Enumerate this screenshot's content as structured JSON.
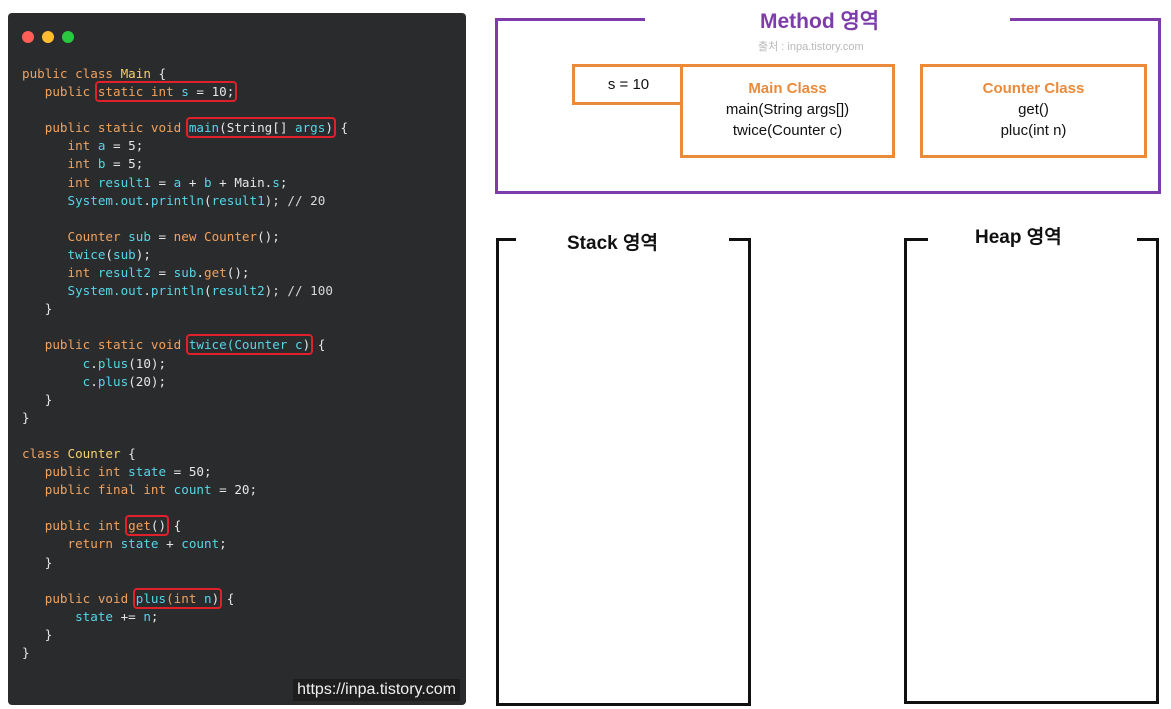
{
  "code_panel": {
    "watermark": "https://inpa.tistory.com",
    "lines": [
      [
        {
          "t": "public ",
          "c": "kw"
        },
        {
          "t": "class ",
          "c": "kw"
        },
        {
          "t": "Main",
          "c": "cls"
        },
        {
          "t": " {",
          "c": "plain"
        }
      ],
      [
        {
          "t": "   public",
          "c": "kw"
        },
        {
          "t": " ",
          "c": "plain"
        },
        {
          "t": "static int ",
          "c": "kw",
          "hl": true
        },
        {
          "t": "s",
          "c": "id",
          "hl": true
        },
        {
          "t": " = 10;",
          "c": "plain",
          "hl": true
        }
      ],
      [],
      [
        {
          "t": "   public static void ",
          "c": "kw"
        },
        {
          "t": "main",
          "c": "id",
          "hl": true
        },
        {
          "t": "(String[] ",
          "c": "plain",
          "hl": true
        },
        {
          "t": "args",
          "c": "id",
          "hl": true
        },
        {
          "t": ")",
          "c": "plain",
          "hl": true
        },
        {
          "t": " {",
          "c": "plain"
        }
      ],
      [
        {
          "t": "      int ",
          "c": "kw"
        },
        {
          "t": "a",
          "c": "id"
        },
        {
          "t": " = 5;",
          "c": "plain"
        }
      ],
      [
        {
          "t": "      int ",
          "c": "kw"
        },
        {
          "t": "b",
          "c": "id"
        },
        {
          "t": " = 5;",
          "c": "plain"
        }
      ],
      [
        {
          "t": "      int ",
          "c": "kw"
        },
        {
          "t": "result1",
          "c": "id"
        },
        {
          "t": " = ",
          "c": "plain"
        },
        {
          "t": "a",
          "c": "id"
        },
        {
          "t": " + ",
          "c": "plain"
        },
        {
          "t": "b",
          "c": "id"
        },
        {
          "t": " + Main.",
          "c": "plain"
        },
        {
          "t": "s",
          "c": "id"
        },
        {
          "t": ";",
          "c": "plain"
        }
      ],
      [
        {
          "t": "      System.",
          "c": "id"
        },
        {
          "t": "out",
          "c": "id"
        },
        {
          "t": ".",
          "c": "plain"
        },
        {
          "t": "println",
          "c": "id"
        },
        {
          "t": "(",
          "c": "plain"
        },
        {
          "t": "result1",
          "c": "id"
        },
        {
          "t": "); // 20",
          "c": "cmt"
        }
      ],
      [],
      [
        {
          "t": "      Counter ",
          "c": "kw"
        },
        {
          "t": "sub",
          "c": "id"
        },
        {
          "t": " = ",
          "c": "plain"
        },
        {
          "t": "new ",
          "c": "kw"
        },
        {
          "t": "Counter",
          "c": "kw"
        },
        {
          "t": "();",
          "c": "plain"
        }
      ],
      [
        {
          "t": "      twice",
          "c": "id"
        },
        {
          "t": "(",
          "c": "plain"
        },
        {
          "t": "sub",
          "c": "id"
        },
        {
          "t": ");",
          "c": "plain"
        }
      ],
      [
        {
          "t": "      int ",
          "c": "kw"
        },
        {
          "t": "result2",
          "c": "id"
        },
        {
          "t": " = ",
          "c": "plain"
        },
        {
          "t": "sub",
          "c": "id"
        },
        {
          "t": ".",
          "c": "plain"
        },
        {
          "t": "get",
          "c": "kw"
        },
        {
          "t": "();",
          "c": "plain"
        }
      ],
      [
        {
          "t": "      System.",
          "c": "id"
        },
        {
          "t": "out",
          "c": "id"
        },
        {
          "t": ".",
          "c": "plain"
        },
        {
          "t": "println",
          "c": "id"
        },
        {
          "t": "(",
          "c": "plain"
        },
        {
          "t": "result2",
          "c": "id"
        },
        {
          "t": "); // 100",
          "c": "cmt"
        }
      ],
      [
        {
          "t": "   }",
          "c": "plain"
        }
      ],
      [],
      [
        {
          "t": "   public static void ",
          "c": "kw"
        },
        {
          "t": "twice",
          "c": "id",
          "hl": true
        },
        {
          "t": "(Counter ",
          "c": "id",
          "hl": true
        },
        {
          "t": "c",
          "c": "id",
          "hl": true
        },
        {
          "t": ")",
          "c": "plain",
          "hl": true
        },
        {
          "t": " {",
          "c": "plain"
        }
      ],
      [
        {
          "t": "        c",
          "c": "id"
        },
        {
          "t": ".",
          "c": "plain"
        },
        {
          "t": "plus",
          "c": "id"
        },
        {
          "t": "(10);",
          "c": "plain"
        }
      ],
      [
        {
          "t": "        c",
          "c": "id"
        },
        {
          "t": ".",
          "c": "plain"
        },
        {
          "t": "plus",
          "c": "id"
        },
        {
          "t": "(20);",
          "c": "plain"
        }
      ],
      [
        {
          "t": "   }",
          "c": "plain"
        }
      ],
      [
        {
          "t": "}",
          "c": "plain"
        }
      ],
      [],
      [
        {
          "t": "class ",
          "c": "kw"
        },
        {
          "t": "Counter",
          "c": "cls"
        },
        {
          "t": " {",
          "c": "plain"
        }
      ],
      [
        {
          "t": "   public int ",
          "c": "kw"
        },
        {
          "t": "state",
          "c": "id"
        },
        {
          "t": " = 50;",
          "c": "plain"
        }
      ],
      [
        {
          "t": "   public final int ",
          "c": "kw"
        },
        {
          "t": "count",
          "c": "id"
        },
        {
          "t": " = 20;",
          "c": "plain"
        }
      ],
      [],
      [
        {
          "t": "   public int",
          "c": "kw"
        },
        {
          "t": " ",
          "c": "plain"
        },
        {
          "t": "get",
          "c": "kw",
          "hl": true
        },
        {
          "t": "()",
          "c": "plain",
          "hl": true
        },
        {
          "t": " {",
          "c": "plain"
        }
      ],
      [
        {
          "t": "      return ",
          "c": "kw"
        },
        {
          "t": "state",
          "c": "id"
        },
        {
          "t": " + ",
          "c": "plain"
        },
        {
          "t": "count",
          "c": "id"
        },
        {
          "t": ";",
          "c": "plain"
        }
      ],
      [
        {
          "t": "   }",
          "c": "plain"
        }
      ],
      [],
      [
        {
          "t": "   public void ",
          "c": "kw"
        },
        {
          "t": "plus",
          "c": "id",
          "hl": true
        },
        {
          "t": "(int ",
          "c": "kw",
          "hl": true
        },
        {
          "t": "n",
          "c": "id",
          "hl": true
        },
        {
          "t": ")",
          "c": "plain",
          "hl": true
        },
        {
          "t": " {",
          "c": "plain"
        }
      ],
      [
        {
          "t": "       state ",
          "c": "id"
        },
        {
          "t": "+= ",
          "c": "plain"
        },
        {
          "t": "n",
          "c": "id"
        },
        {
          "t": ";",
          "c": "plain"
        }
      ],
      [
        {
          "t": "   }",
          "c": "plain"
        }
      ],
      [
        {
          "t": "}",
          "c": "plain"
        }
      ]
    ]
  },
  "method_area": {
    "title": "Method 영역",
    "subtitle": "출처 : inpa.tistory.com",
    "static_var": "s = 10",
    "main_class": {
      "title": "Main Class",
      "methods": [
        "main(String args[])",
        "twice(Counter c)"
      ]
    },
    "counter_class": {
      "title": "Counter Class",
      "methods": [
        "get()",
        "pluc(int n)"
      ]
    }
  },
  "stack_area": {
    "title": "Stack 영역"
  },
  "heap_area": {
    "title": "Heap 영역"
  },
  "colors": {
    "method_border": "#7d3caa",
    "class_box": "#ea8a3b",
    "highlight": "#e0202a",
    "code_bg": "#2a2b2d"
  }
}
